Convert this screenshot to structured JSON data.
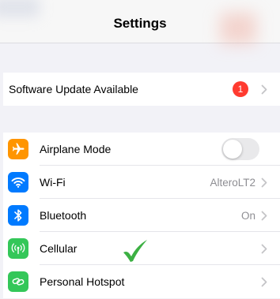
{
  "nav": {
    "title": "Settings"
  },
  "update": {
    "label": "Software Update Available",
    "badge_count": "1"
  },
  "settings": [
    {
      "label": "Airplane Mode",
      "value": "",
      "icon": "airplane-icon",
      "color": "#ff9500"
    },
    {
      "label": "Wi-Fi",
      "value": "AlteroLT2",
      "icon": "wifi-icon",
      "color": "#007aff"
    },
    {
      "label": "Bluetooth",
      "value": "On",
      "icon": "bluetooth-icon",
      "color": "#007aff"
    },
    {
      "label": "Cellular",
      "value": "",
      "icon": "antenna-icon",
      "color": "#34c759"
    },
    {
      "label": "Personal Hotspot",
      "value": "",
      "icon": "link-icon",
      "color": "#34c759"
    }
  ],
  "airplane_mode_on": false,
  "annotation": {
    "icon": "green-checkmark-icon",
    "color": "#3cb043"
  }
}
